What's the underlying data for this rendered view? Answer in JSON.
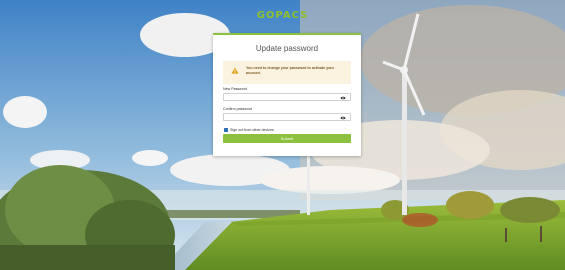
{
  "brand": {
    "logo_text": "GOPACS",
    "logo_color": "#8fbf2c",
    "accent": "#8bc13f"
  },
  "card": {
    "title": "Update password",
    "alert": {
      "icon": "warning-icon",
      "message": "You need to change your password to activate your account."
    },
    "new_password": {
      "label": "New Password",
      "value": "",
      "toggle_icon": "eye-icon"
    },
    "confirm_password": {
      "label": "Confirm password",
      "value": "",
      "toggle_icon": "eye-icon"
    },
    "sign_out_checkbox": {
      "label": "Sign out from other devices",
      "checked": true
    },
    "submit_label": "Submit"
  }
}
